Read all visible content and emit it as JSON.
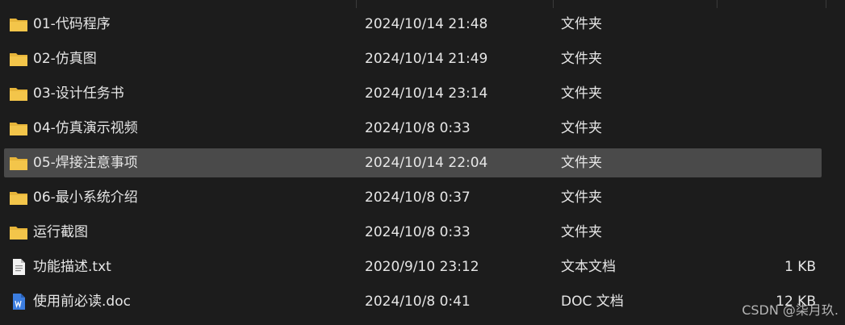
{
  "files": [
    {
      "name": "01-代码程序",
      "date": "2024/10/14 21:48",
      "type": "文件夹",
      "size": "",
      "icon": "folder-icon"
    },
    {
      "name": "02-仿真图",
      "date": "2024/10/14 21:49",
      "type": "文件夹",
      "size": "",
      "icon": "folder-icon"
    },
    {
      "name": "03-设计任务书",
      "date": "2024/10/14 23:14",
      "type": "文件夹",
      "size": "",
      "icon": "folder-icon"
    },
    {
      "name": "04-仿真演示视频",
      "date": "2024/10/8 0:33",
      "type": "文件夹",
      "size": "",
      "icon": "folder-icon"
    },
    {
      "name": "05-焊接注意事项",
      "date": "2024/10/14 22:04",
      "type": "文件夹",
      "size": "",
      "icon": "folder-icon",
      "selected": true
    },
    {
      "name": "06-最小系统介绍",
      "date": "2024/10/8 0:37",
      "type": "文件夹",
      "size": "",
      "icon": "folder-icon"
    },
    {
      "name": "运行截图",
      "date": "2024/10/8 0:33",
      "type": "文件夹",
      "size": "",
      "icon": "folder-icon"
    },
    {
      "name": "功能描述.txt",
      "date": "2020/9/10 23:12",
      "type": "文本文档",
      "size": "1 KB",
      "icon": "text-file-icon"
    },
    {
      "name": "使用前必读.doc",
      "date": "2024/10/8 0:41",
      "type": "DOC 文档",
      "size": "12 KB",
      "icon": "word-doc-icon"
    }
  ],
  "watermark": "CSDN @柒月玖.",
  "colors": {
    "background": "#1c1c1c",
    "selected_row": "#4a4a4a",
    "text": "#e6e6e6",
    "folder": "#f3c54a",
    "word_icon": "#3b7de0"
  }
}
